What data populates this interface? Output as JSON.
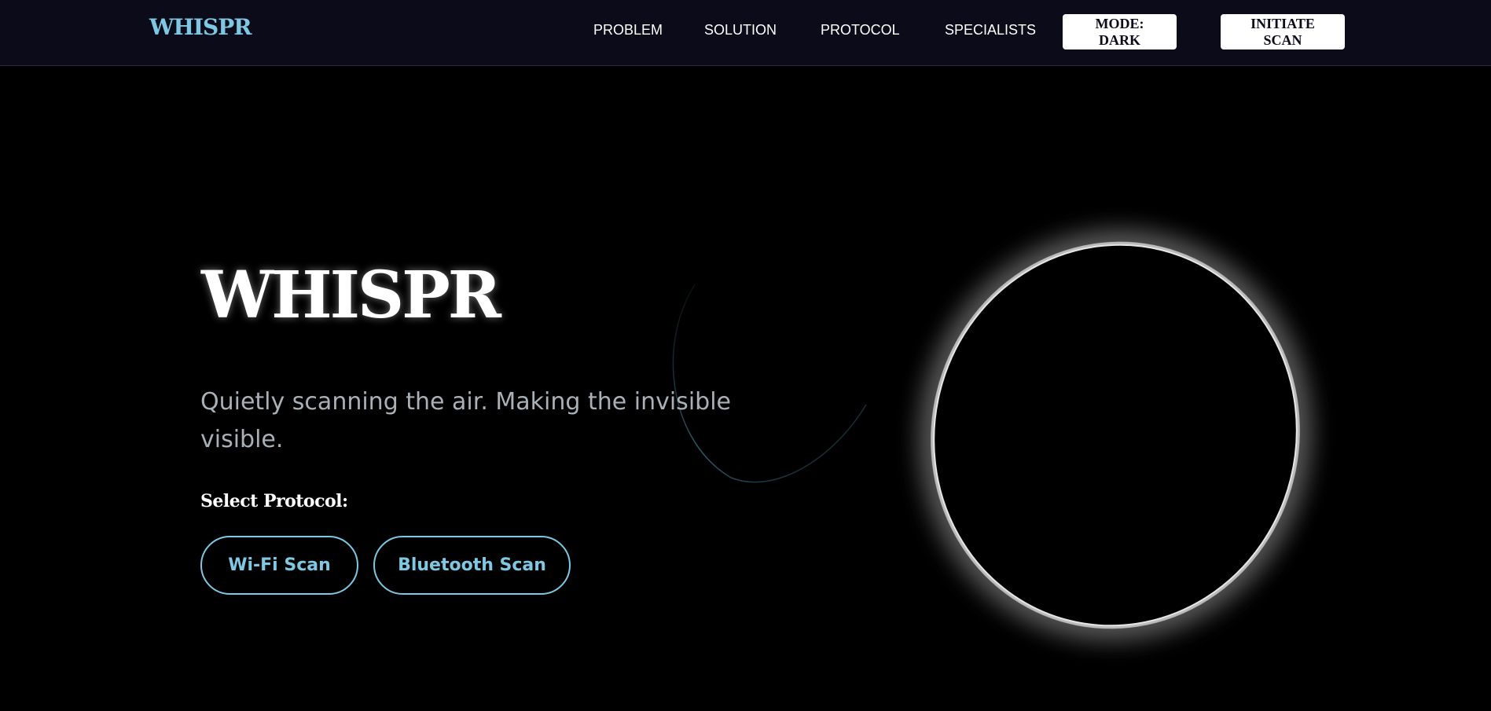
{
  "brand": {
    "name": "WHISPR",
    "color": "#7ec8e3"
  },
  "nav": {
    "links": [
      {
        "label": "PROBLEM"
      },
      {
        "label": "SOLUTION"
      },
      {
        "label": "PROTOCOL"
      },
      {
        "label": "SPECIALISTS"
      }
    ],
    "mode_button": "MODE: DARK",
    "scan_button": "INITIATE SCAN"
  },
  "hero": {
    "title": "WHISPR",
    "subtitle": "Quietly scanning the air. Making the invisible visible.",
    "select_label": "Select Protocol:",
    "protocols": [
      {
        "label": "Wi-Fi Scan"
      },
      {
        "label": "Bluetooth Scan"
      }
    ]
  },
  "colors": {
    "background": "#000000",
    "navbar": "#0b0b1a",
    "accent": "#7ec8e3",
    "text": "#ffffff",
    "muted": "#a8b0b8"
  }
}
